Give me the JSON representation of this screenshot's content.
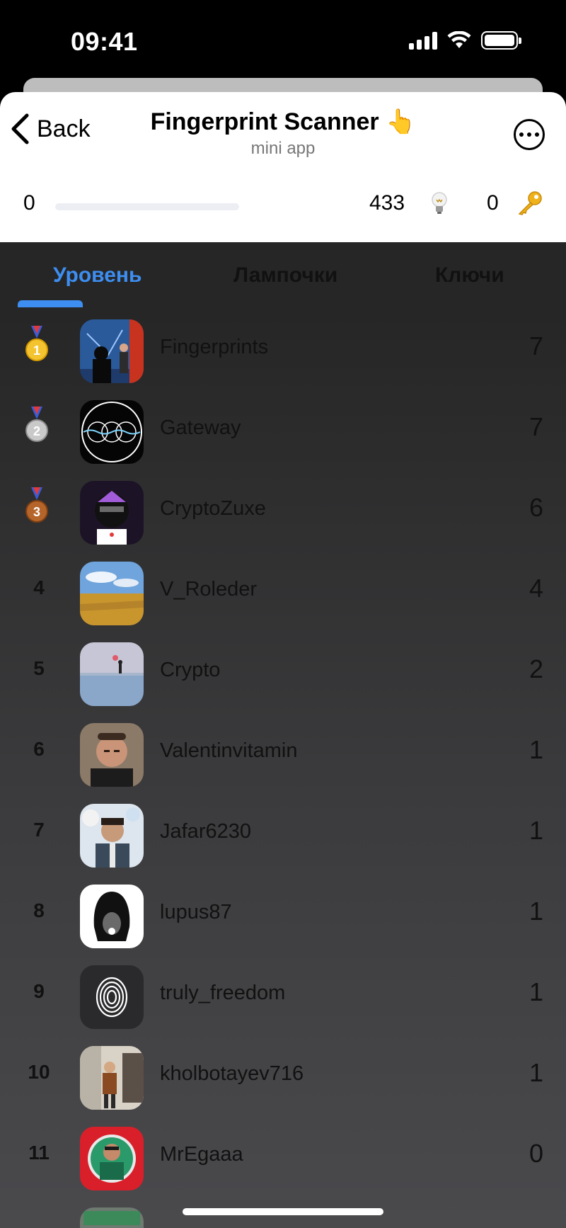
{
  "status_bar": {
    "time": "09:41"
  },
  "header": {
    "back_label": "Back",
    "title": "Fingerprint Scanner 👆",
    "subtitle": "mini app"
  },
  "stats": {
    "level": "0",
    "progress_fraction": 0,
    "bulbs": "433",
    "keys": "0"
  },
  "tabs": [
    {
      "label": "Уровень",
      "active": true
    },
    {
      "label": "Лампочки",
      "active": false
    },
    {
      "label": "Ключи",
      "active": false
    }
  ],
  "leaderboard": [
    {
      "rank": "1",
      "medal": "gold",
      "name": "Fingerprints",
      "score": "7",
      "avatar": "scientist-at-whiteboard"
    },
    {
      "rank": "2",
      "medal": "silver",
      "name": "Gateway",
      "score": "7",
      "avatar": "interlocking-circles-logo"
    },
    {
      "rank": "3",
      "medal": "bronze",
      "name": "CryptoZuxe",
      "score": "6",
      "avatar": "ape-nft"
    },
    {
      "rank": "4",
      "name": "V_Roleder",
      "score": "4",
      "avatar": "wheat-field"
    },
    {
      "rank": "5",
      "name": "Crypto",
      "score": "2",
      "avatar": "winter-landscape"
    },
    {
      "rank": "6",
      "name": "Valentinvitamin",
      "score": "1",
      "avatar": "man-portrait"
    },
    {
      "rank": "7",
      "name": "Jafar6230",
      "score": "1",
      "avatar": "man-with-balloons"
    },
    {
      "rank": "8",
      "name": "lupus87",
      "score": "1",
      "avatar": "hooded-figure-icon"
    },
    {
      "rank": "9",
      "name": "truly_freedom",
      "score": "1",
      "avatar": "fingerprint-icon"
    },
    {
      "rank": "10",
      "name": "kholbotayev716",
      "score": "1",
      "avatar": "man-in-shop"
    },
    {
      "rank": "11",
      "name": "MrEgaaa",
      "score": "0",
      "avatar": "red-badge-portrait"
    }
  ],
  "colors": {
    "accent": "#3d8ef0",
    "list_bg_top": "#262626",
    "list_bg_bottom": "#4a4a4d"
  }
}
